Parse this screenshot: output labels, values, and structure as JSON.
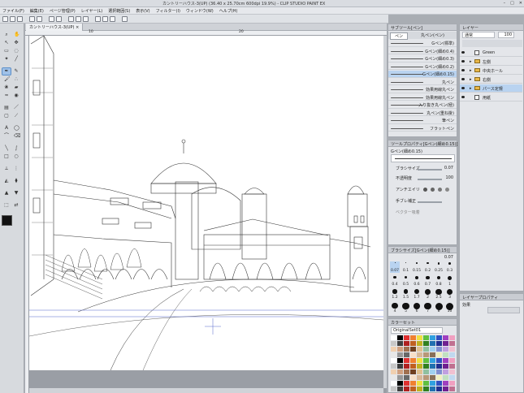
{
  "window": {
    "title": "カントリーハウス-3(UP) (36.40 x 25.70cm 600dpi 19.9%) - CLIP STUDIO PAINT EX",
    "min": "–",
    "max": "□",
    "close": "✕"
  },
  "menu": [
    "ファイル(F)",
    "編集(E)",
    "ページ管理(P)",
    "レイヤー(L)",
    "選択範囲(S)",
    "表示(V)",
    "フィルター(I)",
    "ウィンドウ(W)",
    "ヘルプ(H)"
  ],
  "document": {
    "tab": "カントリーハウス-3(UP)",
    "close": "×",
    "ruler_marks": [
      "10",
      "20"
    ]
  },
  "subtool_panel": {
    "title": "サブツール[ペン]",
    "tabs": [
      "ペン",
      "丸ペン(ペン)"
    ],
    "brushes": [
      {
        "name": "Gペン(標準)",
        "selected": false
      },
      {
        "name": "Gペン(細め0.4)",
        "selected": false
      },
      {
        "name": "Gペン(細め0.3)",
        "selected": false
      },
      {
        "name": "Gペン(細め0.2)",
        "selected": false
      },
      {
        "name": "Gペン(細め0.15)",
        "selected": true
      },
      {
        "name": "丸ペン",
        "selected": false
      },
      {
        "name": "効果用線丸ペン",
        "selected": false
      },
      {
        "name": "効果用線丸ペン",
        "selected": false
      },
      {
        "name": "入り抜き丸ペン(極)",
        "selected": false
      },
      {
        "name": "丸ペン(重ね掛)",
        "selected": false
      },
      {
        "name": "筆ペン",
        "selected": false
      },
      {
        "name": "フラットペン",
        "selected": false
      }
    ]
  },
  "tool_property": {
    "title": "ツールプロパティ[Gペン(細め0.15)]",
    "brush_name": "Gペン(細め0.15)",
    "rows": [
      {
        "label": "ブラシサイズ",
        "value": "0.07"
      },
      {
        "label": "不透明度",
        "value": "100"
      },
      {
        "label": "アンチエイリ",
        "value": ""
      },
      {
        "label": "手ブレ補正",
        "value": ""
      },
      {
        "label": "ベクター吸着",
        "value": ""
      }
    ]
  },
  "brush_size": {
    "title": "ブラシサイズ[Gペン(細め0.15)]",
    "current": "0.07",
    "sizes": [
      "0.07",
      "0.1",
      "0.15",
      "0.2",
      "0.25",
      "0.3",
      "0.4",
      "0.5",
      "0.6",
      "0.7",
      "0.8",
      "1",
      "1.2",
      "1.5",
      "1.7",
      "2",
      "2.5",
      "3",
      "4",
      "5",
      "6",
      "7",
      "8",
      "10"
    ]
  },
  "color_set": {
    "title": "カラーセット",
    "set_name": "OriginalSet01"
  },
  "layer_panel": {
    "title": "レイヤー",
    "blend_mode": "通常",
    "opacity": "100",
    "layers": [
      {
        "name": "Green",
        "type": "layer",
        "selected": false,
        "arrow": ""
      },
      {
        "name": "左側",
        "type": "folder",
        "selected": false,
        "arrow": "▸"
      },
      {
        "name": "中央ホール",
        "type": "folder",
        "selected": false,
        "arrow": "▸"
      },
      {
        "name": "右側",
        "type": "folder",
        "selected": false,
        "arrow": "▸"
      },
      {
        "name": "パース定規",
        "type": "folder",
        "selected": true,
        "arrow": "▸"
      },
      {
        "name": "用紙",
        "type": "layer",
        "selected": false,
        "arrow": ""
      }
    ]
  },
  "layer_property": {
    "title": "レイヤープロパティ",
    "effect": "効果"
  },
  "colors": {
    "accent": "#5c8fc9",
    "selected": "#b9d3f0",
    "panel": "#e4e6ea",
    "main_color": "#111111",
    "sub_color": "#ffffff"
  }
}
